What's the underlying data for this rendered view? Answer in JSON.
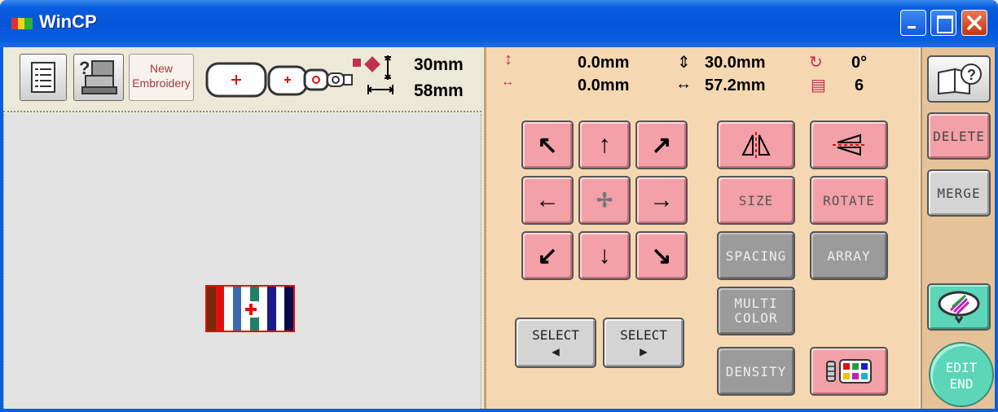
{
  "window": {
    "title": "WinCP",
    "icons": {
      "app": "app-color-icon",
      "minimize": "minimize-icon",
      "maximize": "maximize-icon",
      "close": "close-icon"
    }
  },
  "toolbar": {
    "new_embroidery_line1": "New",
    "new_embroidery_line2": "Embroidery",
    "height": "30mm",
    "width": "58mm",
    "icons": [
      "page-list-icon",
      "machine-help-icon",
      "hoop-large-icon",
      "hoop-medium-icon",
      "hoop-small-icon",
      "design-size-icon"
    ]
  },
  "info": {
    "vertical_offset": "0.0mm",
    "horizontal_offset": "0.0mm",
    "height": "30.0mm",
    "width": "57.2mm",
    "angle": "0°",
    "colors": "6"
  },
  "edit": {
    "size": "SIZE",
    "rotate": "ROTATE",
    "spacing": "SPACING",
    "array": "ARRAY",
    "multi_color_line1": "MULTI",
    "multi_color_line2": "COLOR",
    "density": "DENSITY",
    "select_prev": "SELECT",
    "select_next": "SELECT"
  },
  "side": {
    "delete": "DELETE",
    "merge": "MERGE",
    "edit_end_line1": "EDIT",
    "edit_end_line2": "END"
  },
  "design": {
    "stripe_colors": [
      "#7a2a0a",
      "#e01010",
      "#ffffff",
      "#3a6ab0",
      "#ffffff",
      "#20806a",
      "#ffffff",
      "#1a1a8a",
      "#ffffff",
      "#0a0a4a"
    ]
  }
}
